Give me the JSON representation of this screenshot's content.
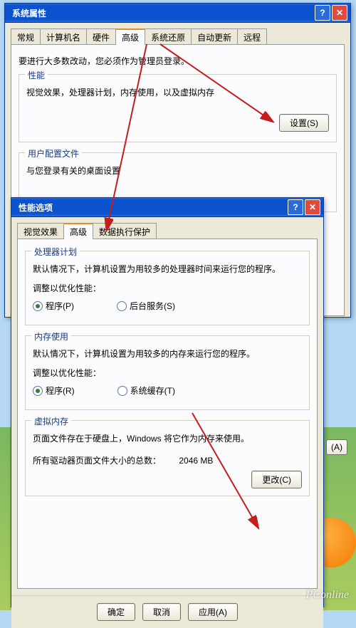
{
  "sysprops": {
    "title": "系统属性",
    "tabs": [
      "常规",
      "计算机名",
      "硬件",
      "高级",
      "系统还原",
      "自动更新",
      "远程"
    ],
    "info": "要进行大多数改动，您必须作为管理员登录。",
    "perf": {
      "groupTitle": "性能",
      "desc": "视觉效果，处理器计划，内存使用，以及虚拟内存",
      "settingsBtn": "设置(S)"
    },
    "userprofile": {
      "groupTitle": "用户配置文件",
      "desc": "与您登录有关的桌面设置"
    }
  },
  "perfopts": {
    "title": "性能选项",
    "tabs": [
      "视觉效果",
      "高级",
      "数据执行保护"
    ],
    "cpu": {
      "groupTitle": "处理器计划",
      "desc": "默认情况下，计算机设置为用较多的处理器时间来运行您的程序。",
      "adjust": "调整以优化性能：",
      "optPrograms": "程序(P)",
      "optBackground": "后台服务(S)"
    },
    "mem": {
      "groupTitle": "内存使用",
      "desc": "默认情况下，计算机设置为用较多的内存来运行您的程序。",
      "adjust": "调整以优化性能：",
      "optPrograms": "程序(R)",
      "optCache": "系统缓存(T)"
    },
    "vm": {
      "groupTitle": "虚拟内存",
      "desc": "页面文件存在于硬盘上，Windows 将它作为内存来使用。",
      "totalLabel": "所有驱动器页面文件大小的总数：",
      "totalValue": "2046 MB",
      "changeBtn": "更改(C)"
    },
    "btns": {
      "ok": "确定",
      "cancel": "取消",
      "apply": "应用(A)"
    },
    "sideBtnSuffix": "(A)"
  },
  "watermark": "PConline"
}
